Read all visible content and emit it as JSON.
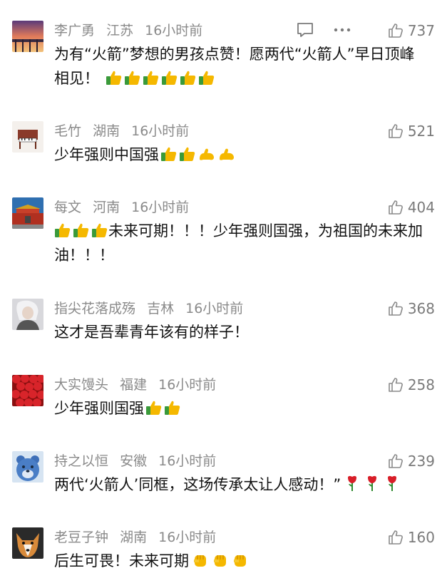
{
  "comments": [
    {
      "user": "李广勇",
      "region": "江苏",
      "time": "16小时前",
      "likes": "737",
      "text": "为有“火箭”梦想的男孩点赞！愿两代“火箭人”早日顶峰相见！",
      "emojis": [
        "thumbs-up",
        "thumbs-up",
        "thumbs-up",
        "thumbs-up",
        "thumbs-up",
        "thumbs-up"
      ],
      "avatar": "pier-sunset",
      "has_actions": true
    },
    {
      "user": "毛竹",
      "region": "湖南",
      "time": "16小时前",
      "likes": "521",
      "text": "少年强则中国强",
      "emojis": [
        "thumbs-up",
        "thumbs-up",
        "flexed-biceps",
        "flexed-biceps"
      ],
      "avatar": "piano"
    },
    {
      "user": "每文",
      "region": "河南",
      "time": "16小时前",
      "likes": "404",
      "emojis_before": [
        "thumbs-up",
        "thumbs-up",
        "thumbs-up"
      ],
      "text": "未来可期！！！少年强则国强，为祖国的未来加油！！！",
      "avatar": "tiananmen"
    },
    {
      "user": "指尖花落成殇",
      "region": "吉林",
      "time": "16小时前",
      "likes": "368",
      "text": "这才是吾辈青年该有的样子！",
      "emojis": [],
      "avatar": "portrait"
    },
    {
      "user": "大实馒头",
      "region": "福建",
      "time": "16小时前",
      "likes": "258",
      "text": "少年强则国强",
      "emojis": [
        "thumbs-up",
        "thumbs-up"
      ],
      "avatar": "strawberries"
    },
    {
      "user": "持之以恒",
      "region": "安徽",
      "time": "16小时前",
      "likes": "239",
      "text": "两代‘火箭人’同框，这场传承太让人感动！”",
      "emojis": [
        "rose",
        "rose",
        "rose"
      ],
      "avatar": "bear"
    },
    {
      "user": "老豆子钟",
      "region": "湖南",
      "time": "16小时前",
      "likes": "160",
      "text": "后生可畏！未来可期",
      "emojis": [
        "fist",
        "fist",
        "fist"
      ],
      "avatar": "dog"
    }
  ],
  "colors": {
    "meta": "#8a8a8a",
    "text": "#111111",
    "like": "#7a7a7a"
  }
}
